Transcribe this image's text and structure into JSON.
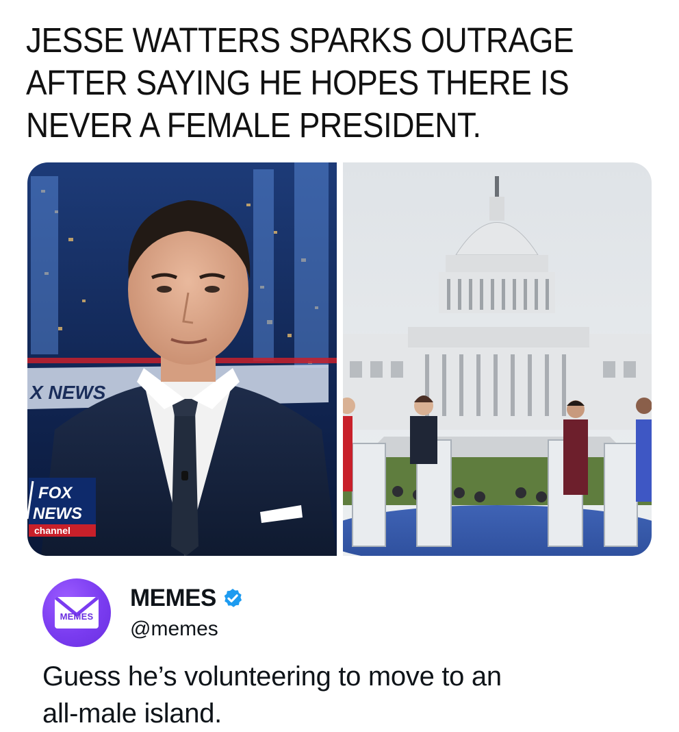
{
  "headline": {
    "lines": [
      "JESSE WATTERS SPARKS OUTRAGE",
      "AFTER SAYING HE HOPES THERE IS",
      "NEVER A FEMALE PRESIDENT."
    ]
  },
  "media": {
    "left_image": {
      "description_icon": "news-anchor-photo",
      "lower_third_text": "X NEWS",
      "logo_line1": "FOX",
      "logo_line2": "NEWS",
      "logo_line3": "channel"
    },
    "right_image": {
      "description_icon": "capitol-debate-photo"
    }
  },
  "author": {
    "avatar_text": "MEMES",
    "name": "MEMES",
    "handle": "@memes",
    "verified_icon": "verified-badge-icon",
    "avatar_color": "#7a3cf0",
    "verified_color": "#1d9bf0"
  },
  "tweet": {
    "lines": [
      "Guess he’s volunteering to move to an",
      "all-male island."
    ]
  }
}
